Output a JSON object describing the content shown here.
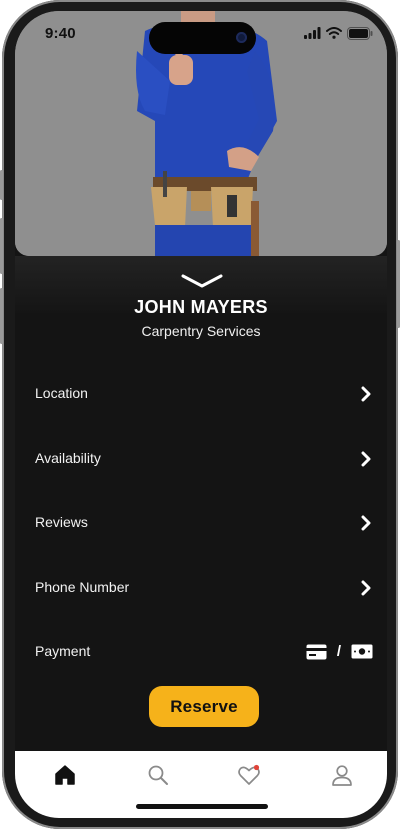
{
  "status_bar": {
    "time": "9:40"
  },
  "profile": {
    "name": "JOHN MAYERS",
    "service": "Carpentry Services"
  },
  "menu": {
    "location": "Location",
    "availability": "Availability",
    "reviews": "Reviews",
    "phone": "Phone Number",
    "payment": "Payment",
    "payment_separator": "/"
  },
  "actions": {
    "reserve_label": "Reserve"
  },
  "tabs": [
    "home-icon",
    "search-icon",
    "heart-icon",
    "user-icon"
  ],
  "colors": {
    "accent": "#f6b21a",
    "background": "#141414",
    "notification_dot": "#e0443a"
  }
}
